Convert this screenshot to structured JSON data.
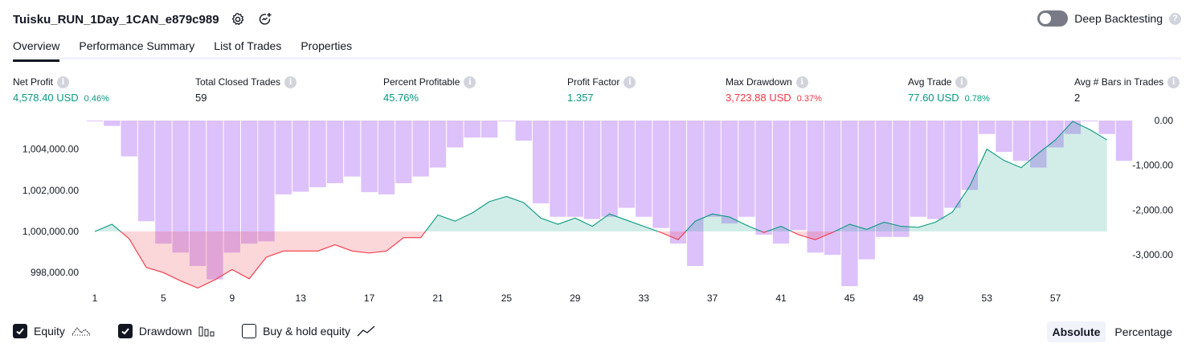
{
  "header": {
    "strategy_name": "Tuisku_RUN_1Day_1CAN_e879c989",
    "deep_backtesting_label": "Deep Backtesting",
    "deep_backtesting_on": false
  },
  "tabs": [
    {
      "label": "Overview",
      "active": true
    },
    {
      "label": "Performance Summary",
      "active": false
    },
    {
      "label": "List of Trades",
      "active": false
    },
    {
      "label": "Properties",
      "active": false
    }
  ],
  "metrics": [
    {
      "label": "Net Profit",
      "value": "4,578.40 USD",
      "pct": "0.46%",
      "color": "green"
    },
    {
      "label": "Total Closed Trades",
      "value": "59",
      "pct": "",
      "color": "dark"
    },
    {
      "label": "Percent Profitable",
      "value": "45.76%",
      "pct": "",
      "color": "green"
    },
    {
      "label": "Profit Factor",
      "value": "1.357",
      "pct": "",
      "color": "green"
    },
    {
      "label": "Max Drawdown",
      "value": "3,723.88 USD",
      "pct": "0.37%",
      "color": "red"
    },
    {
      "label": "Avg Trade",
      "value": "77.60 USD",
      "pct": "0.78%",
      "color": "green"
    },
    {
      "label": "Avg # Bars in Trades",
      "value": "2",
      "pct": "",
      "color": "dark"
    }
  ],
  "chart_data": {
    "type": "area",
    "x_ticks": [
      "1",
      "5",
      "9",
      "13",
      "17",
      "21",
      "25",
      "29",
      "33",
      "37",
      "41",
      "45",
      "49",
      "53",
      "57"
    ],
    "left_axis": {
      "ticks": [
        "1,004,000.00",
        "1,002,000.00",
        "1,000,000.00",
        "998,000.00"
      ],
      "tick_values": [
        1004000,
        1002000,
        1000000,
        998000
      ],
      "baseline": 1000000
    },
    "right_axis": {
      "ticks": [
        "0.00",
        "-1,000.00",
        "-2,000.00",
        "-3,000.00"
      ],
      "tick_values": [
        0,
        -1000,
        -2000,
        -3000
      ]
    },
    "series": [
      {
        "name": "Equity",
        "x": [
          1,
          2,
          3,
          4,
          5,
          6,
          7,
          8,
          9,
          10,
          11,
          12,
          13,
          14,
          15,
          16,
          17,
          18,
          19,
          20,
          21,
          22,
          23,
          24,
          25,
          26,
          27,
          28,
          29,
          30,
          31,
          32,
          33,
          34,
          35,
          36,
          37,
          38,
          39,
          40,
          41,
          42,
          43,
          44,
          45,
          46,
          47,
          48,
          49,
          50,
          51,
          52,
          53,
          54,
          55,
          56,
          57,
          58,
          59,
          60
        ],
        "values": [
          1000000,
          1000350,
          999650,
          998250,
          998000,
          997600,
          997250,
          997650,
          998150,
          997700,
          998750,
          999050,
          999050,
          999050,
          999350,
          999050,
          998950,
          999050,
          999700,
          999700,
          1000800,
          1000500,
          1000900,
          1001450,
          1001700,
          1001400,
          1000650,
          1000350,
          1000650,
          1000250,
          1000850,
          1000550,
          1000250,
          999950,
          999600,
          1000500,
          1000850,
          1000700,
          1000300,
          999950,
          1000250,
          999850,
          999600,
          999950,
          1000350,
          1000100,
          1000450,
          1000250,
          1000200,
          1000450,
          1000950,
          1002200,
          1004000,
          1003450,
          1003100,
          1003800,
          1004450,
          1005350,
          1004950,
          1004450
        ],
        "color": "#089981"
      },
      {
        "name": "Drawdown",
        "values": [
          0,
          -120,
          -800,
          -2250,
          -2750,
          -2950,
          -3250,
          -3550,
          -2950,
          -2750,
          -2700,
          -1650,
          -1590,
          -1490,
          -1400,
          -1250,
          -1600,
          -1650,
          -1400,
          -1250,
          -1050,
          -600,
          -380,
          -380,
          0,
          -450,
          -1850,
          -2150,
          -2150,
          -2200,
          -2150,
          -1950,
          -2150,
          -2400,
          -2750,
          -3250,
          -2150,
          -2300,
          -2150,
          -2550,
          -2750,
          -2450,
          -2950,
          -3000,
          -3700,
          -3100,
          -2600,
          -2600,
          -2150,
          -2200,
          -1950,
          -1550,
          -300,
          -700,
          -900,
          -1050,
          -600,
          -300,
          0,
          -300,
          -900
        ],
        "color": "#b39ddb"
      }
    ]
  },
  "legend": [
    {
      "label": "Equity",
      "checked": true,
      "icon": "equity-line-icon"
    },
    {
      "label": "Drawdown",
      "checked": true,
      "icon": "drawdown-bars-icon"
    },
    {
      "label": "Buy & hold equity",
      "checked": false,
      "icon": "buy-hold-line-icon"
    }
  ],
  "mode": {
    "absolute": "Absolute",
    "percentage": "Percentage",
    "active": "absolute"
  }
}
